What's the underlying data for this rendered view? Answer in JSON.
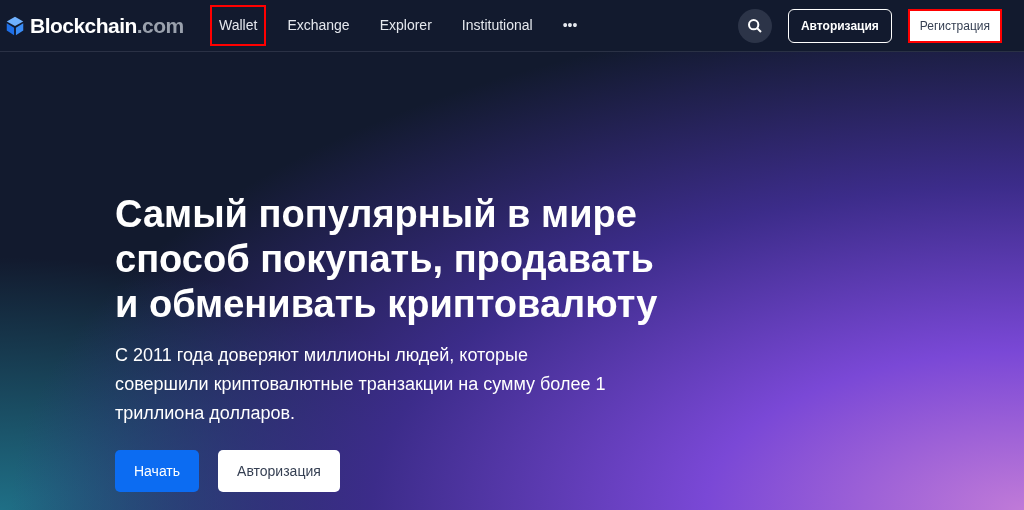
{
  "brand": {
    "name": "Blockchain",
    "suffix": ".com"
  },
  "nav": [
    {
      "label": "Wallet",
      "highlighted": true
    },
    {
      "label": "Exchange",
      "highlighted": false
    },
    {
      "label": "Explorer",
      "highlighted": false
    },
    {
      "label": "Institutional",
      "highlighted": false
    },
    {
      "label": "•••",
      "highlighted": false
    }
  ],
  "header_buttons": [
    {
      "label": "Авторизация",
      "kind": "outline",
      "highlighted": false
    },
    {
      "label": "Регистрация",
      "kind": "solid",
      "highlighted": true
    }
  ],
  "hero": {
    "title": "Самый популярный в мире способ покупать, продавать и обменивать криптовалюту",
    "subtitle": "С 2011 года доверяют миллионы людей, которые совершили криптовалютные транзакции на сумму более 1 триллиона долларов.",
    "buttons": [
      {
        "label": "Начать",
        "kind": "primary"
      },
      {
        "label": "Авторизация",
        "kind": "secondary"
      }
    ]
  }
}
